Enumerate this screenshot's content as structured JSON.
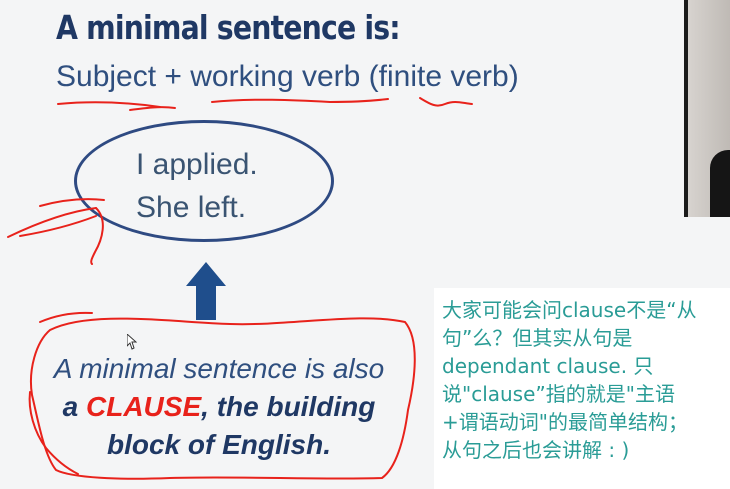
{
  "slide": {
    "title": "A minimal sentence is:",
    "subtitle": "Subject + working verb (finite verb)",
    "examples": [
      "I applied.",
      "She left."
    ],
    "definition": {
      "line1": "A minimal sentence is also",
      "line2_prefix": "a ",
      "line2_highlight": "CLAUSE",
      "line2_suffix": ", the building",
      "line3": "block of English."
    }
  },
  "note": {
    "lines": [
      "大家可能会问clause不是“从",
      "句”么？但其实从句是",
      "dependant clause. 只",
      "说\"clause”指的就是\"主语",
      "+谓语动词\"的最简单结构；",
      "从句之后也会讲解 : )"
    ]
  },
  "colors": {
    "title": "#1f3864",
    "text": "#2f4f7f",
    "clause": "#e8221b",
    "annotation": "#e8221b",
    "note_text": "#2a9c96",
    "arrow": "#1f4e8c"
  },
  "icons": {
    "arrow": "up-arrow-icon",
    "cursor": "mouse-cursor-icon"
  }
}
